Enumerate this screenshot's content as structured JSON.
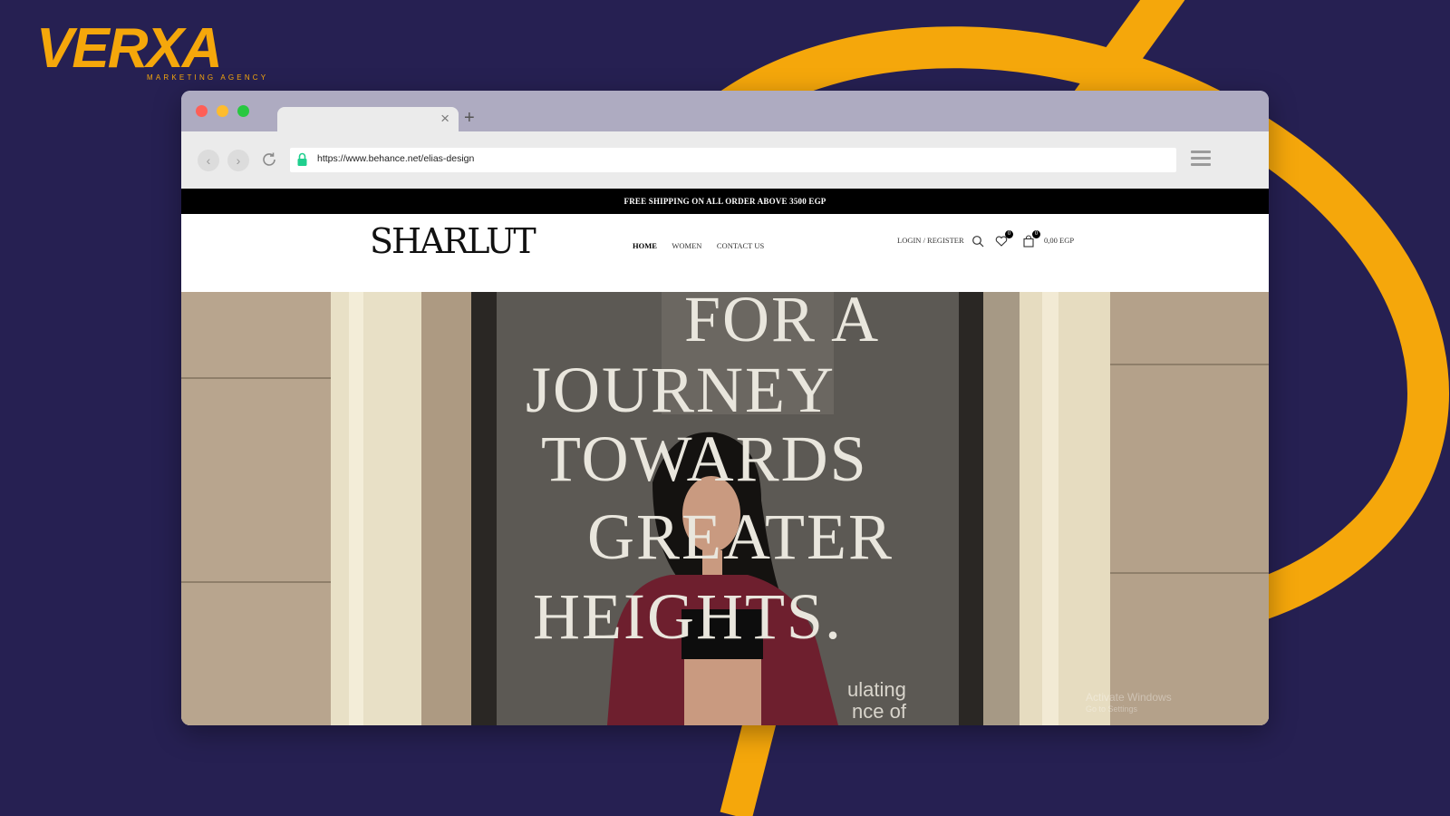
{
  "agency": {
    "logo_text": "VERXA",
    "tagline": "MARKETING AGENCY",
    "accent_color": "#f5a70b",
    "background_color": "#262052"
  },
  "browser": {
    "tab_close_icon": "×",
    "new_tab_icon": "+",
    "back_icon": "‹",
    "forward_icon": "›",
    "url": "https://www.behance.net/elias-design"
  },
  "site": {
    "promo_text": "FREE SHIPPING ON ALL ORDER ABOVE  3500 EGP",
    "logo_text": "SHARLUT",
    "nav": [
      {
        "label": "HOME",
        "active": true
      },
      {
        "label": "WOMEN",
        "active": false
      },
      {
        "label": "CONTACT US",
        "active": false
      }
    ],
    "login_label": "LOGIN / REGISTER",
    "wishlist_count": "0",
    "cart_count": "0",
    "cart_total": "0,00 EGP"
  },
  "hero": {
    "lines": [
      "FOR A",
      "JOURNEY",
      "TOWARDS",
      "GREATER",
      "HEIGHTS."
    ],
    "sub_lines": [
      "ulating",
      "nce of"
    ],
    "watermark_lines": [
      "Activate Windows",
      "Go to Settings"
    ]
  }
}
